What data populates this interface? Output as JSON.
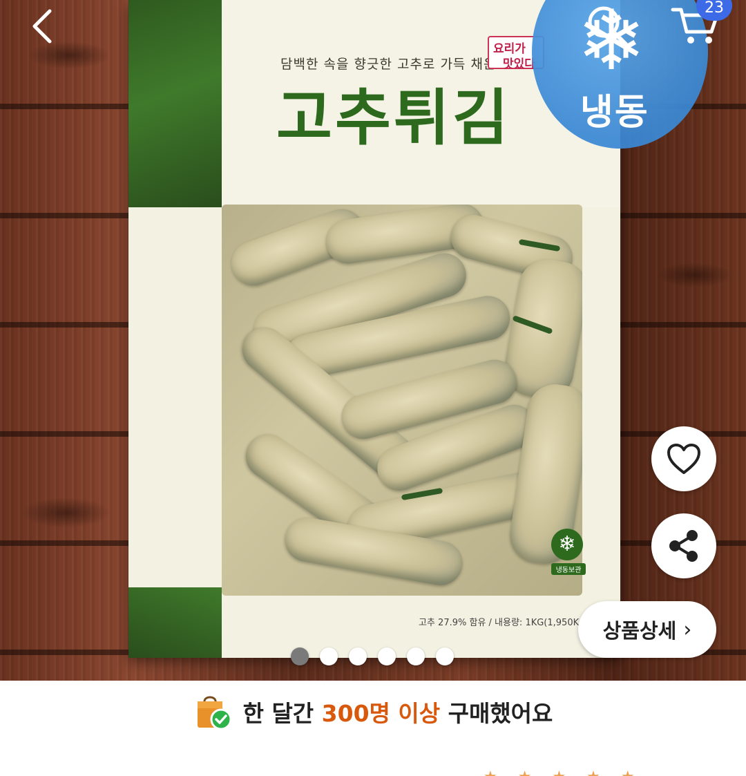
{
  "product": {
    "tagline": "담백한 속을 향긋한 고추로 가득 채운",
    "title": "고추튀김",
    "badge_line1": "요리가",
    "badge_line2": "맛있다",
    "seal_label": "냉동보관",
    "footer_text": "고추 27.9% 함유 / 내용량: 1KG(1,950Kcal)"
  },
  "frozen_badge": {
    "label": "냉동",
    "icon": "snowflake-icon"
  },
  "header": {
    "back_icon": "chevron-left-icon",
    "search_icon": "search-icon",
    "cart_icon": "cart-icon",
    "cart_count": "23"
  },
  "actions": {
    "like_icon": "heart-icon",
    "share_icon": "share-icon",
    "detail_label": "상품상세",
    "detail_chevron": "›"
  },
  "carousel": {
    "total": 6,
    "active_index": 0
  },
  "purchase_banner": {
    "prefix": "한 달간 ",
    "highlight": "300명 이상",
    "suffix": " 구매했어요",
    "icon": "shopping-bag-check-icon"
  },
  "colors": {
    "accent_orange": "#d8580c",
    "frozen_blue": "#3b88d4",
    "cart_badge": "#3d6be8",
    "pkg_green": "#2e6a1e"
  }
}
